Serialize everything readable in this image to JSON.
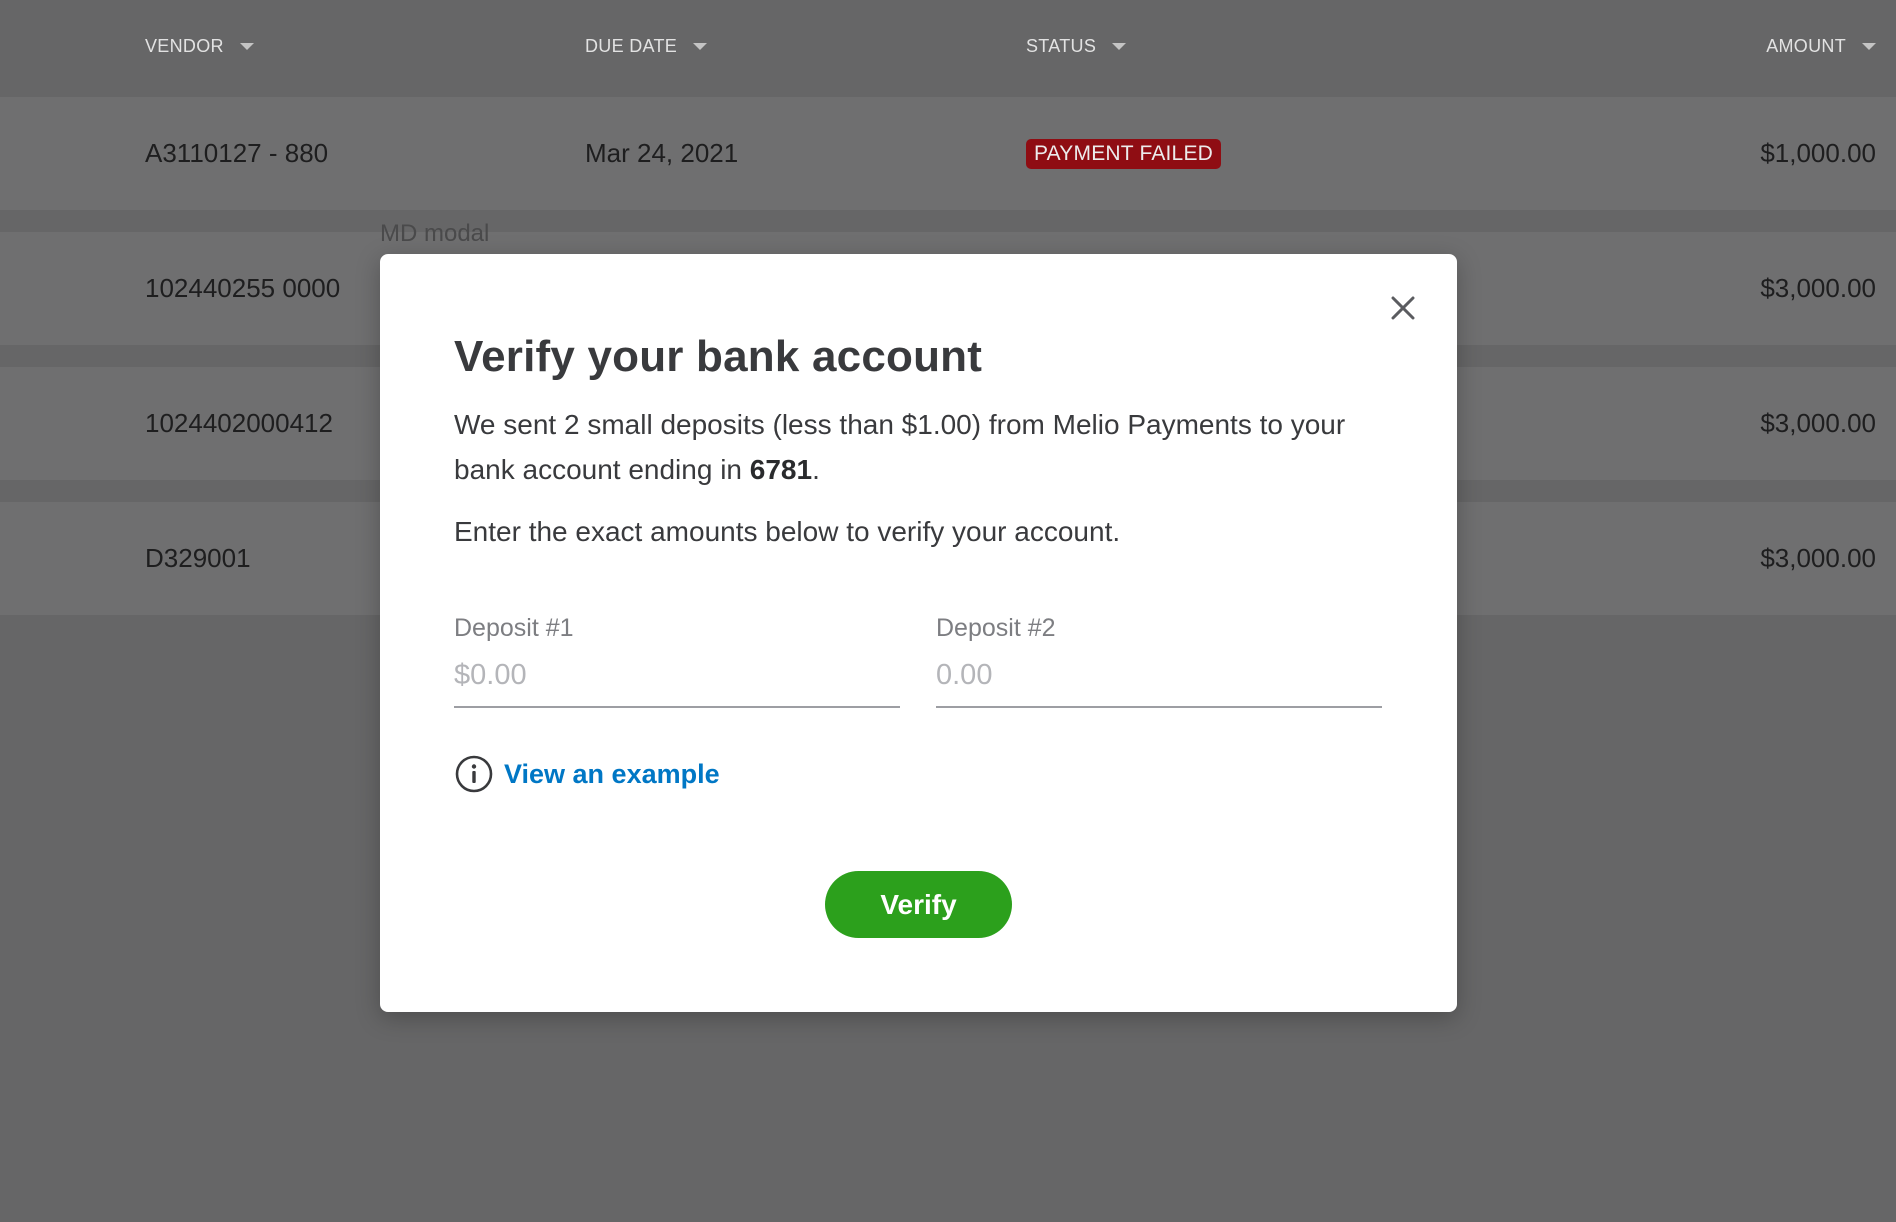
{
  "table": {
    "columns": [
      "VENDOR",
      "DUE DATE",
      "STATUS",
      "AMOUNT"
    ],
    "rows": [
      {
        "vendor": "A3110127 - 880",
        "due_date": "Mar 24, 2021",
        "status": "PAYMENT FAILED",
        "amount": "$1,000.00"
      },
      {
        "vendor": "102440255 0000",
        "due_date": "",
        "status": "",
        "amount": "$3,000.00"
      },
      {
        "vendor": "1024402000412",
        "due_date": "",
        "status": "",
        "amount": "$3,000.00"
      },
      {
        "vendor": "D329001",
        "due_date": "",
        "status": "",
        "amount": "$3,000.00"
      }
    ]
  },
  "modal_label": "MD modal",
  "modal": {
    "title": "Verify your bank account",
    "desc_prefix": "We sent 2 small deposits (less than $1.00) from Melio Payments to your bank account ending in ",
    "account_last4": "6781",
    "desc_suffix": ".",
    "instructions": "Enter the exact amounts below to verify your account.",
    "deposit1": {
      "label": "Deposit #1",
      "placeholder": "$0.00",
      "value": ""
    },
    "deposit2": {
      "label": "Deposit #2",
      "placeholder": "0.00",
      "value": ""
    },
    "example_link": "View an example",
    "verify_button": "Verify",
    "close_icon": "close-icon",
    "info_icon": "info-icon"
  },
  "colors": {
    "overlay_bg": "#666667",
    "status_failed": "#8f0d13",
    "link": "#0077c5",
    "primary_button": "#2ca01c"
  }
}
